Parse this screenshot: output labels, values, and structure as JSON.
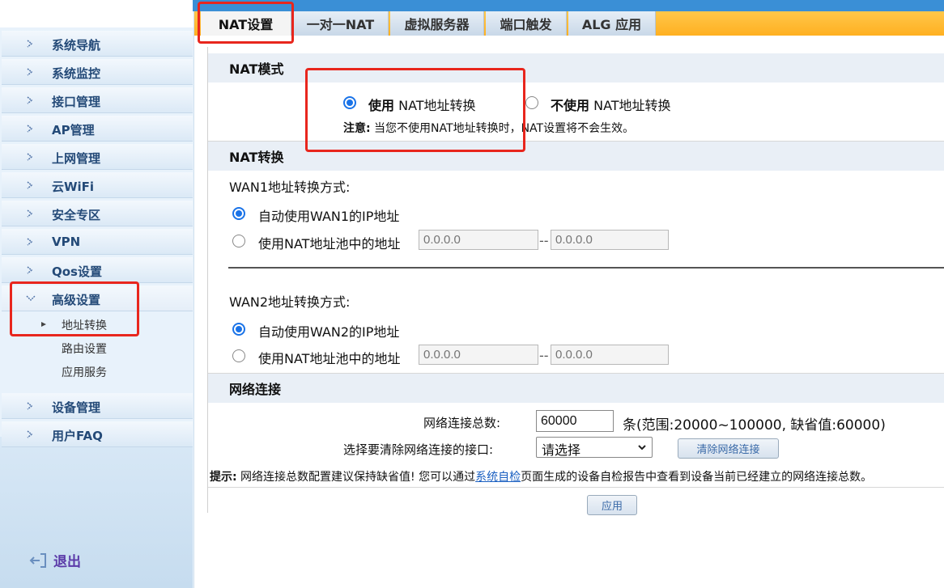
{
  "sidebar": {
    "items": [
      {
        "label": "系统导航"
      },
      {
        "label": "系统监控"
      },
      {
        "label": "接口管理"
      },
      {
        "label": "AP管理"
      },
      {
        "label": "上网管理"
      },
      {
        "label": "云WiFi"
      },
      {
        "label": "安全专区"
      },
      {
        "label": "VPN"
      },
      {
        "label": "Qos设置"
      },
      {
        "label": "高级设置"
      },
      {
        "label": "设备管理"
      },
      {
        "label": "用户FAQ"
      }
    ],
    "sub_items": [
      "地址转换",
      "路由设置",
      "应用服务"
    ],
    "logout_label": "退出"
  },
  "tabs": [
    "NAT设置",
    "一对一NAT",
    "虚拟服务器",
    "端口触发",
    "ALG 应用"
  ],
  "nat_mode": {
    "title": "NAT模式",
    "use_bold": "使用",
    "use_rest": " NAT地址转换",
    "nouse_bold": "不使用",
    "nouse_rest": " NAT地址转换",
    "note_label": "注意:",
    "note_text": " 当您不使用NAT地址转换时，NAT设置将不会生效。"
  },
  "nat_convert": {
    "title": "NAT转换",
    "wan1_label": "WAN1地址转换方式:",
    "wan1_auto": "自动使用WAN1的IP地址",
    "pool_label": "使用NAT地址池中的地址",
    "wan2_label": "WAN2地址转换方式:",
    "wan2_auto": "自动使用WAN2的IP地址",
    "ip_placeholder": "0.0.0.0",
    "dash": "--"
  },
  "conn": {
    "title": "网络连接",
    "total_label": "网络连接总数:",
    "total_value": "60000",
    "range_text": "条(范围:20000~100000, 缺省值:60000)",
    "clear_label": "选择要清除网络连接的接口:",
    "select_value": "请选择",
    "clear_button": "清除网络连接",
    "tip_label": "提示:",
    "tip_pre": " 网络连接总数配置建议保持缺省值! 您可以通过",
    "tip_link": "系统自检",
    "tip_post": "页面生成的设备自检报告中查看到设备当前已经建立的网络连接总数。"
  },
  "apply_button": "应用",
  "colors": {
    "accent": "#1a73e8",
    "highlight": "#e8261d",
    "tabstrip": "#ffb021",
    "nav_text": "#244a78"
  }
}
